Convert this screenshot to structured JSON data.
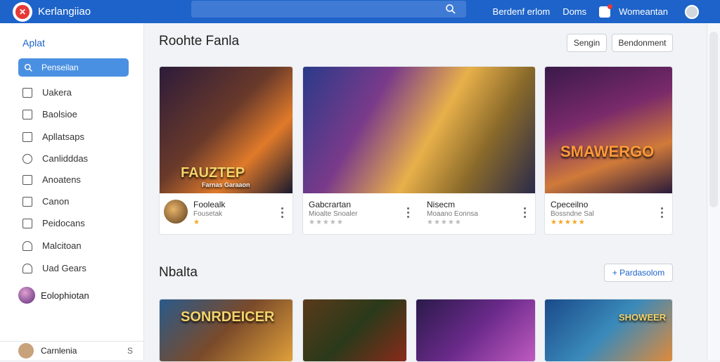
{
  "header": {
    "app_title": "Kerlangiiao",
    "links": [
      "Berdenf erlom",
      "Doms"
    ],
    "user_name": "Womeantan",
    "colors": {
      "bar": "#1d63c9"
    }
  },
  "sidebar": {
    "heading": "Aplat",
    "search_label": "Penseilan",
    "items": [
      {
        "label": "Uakera",
        "icon": "calendar-icon"
      },
      {
        "label": "Baolsioe",
        "icon": "chart-icon"
      },
      {
        "label": "Apllatsaps",
        "icon": "bar-chart-icon"
      },
      {
        "label": "Canlidddas",
        "icon": "search-icon"
      },
      {
        "label": "Anoatens",
        "icon": "list-icon"
      },
      {
        "label": "Canon",
        "icon": "bracket-icon"
      },
      {
        "label": "Peidocans",
        "icon": "image-icon"
      },
      {
        "label": "Malcitoan",
        "icon": "person-icon"
      },
      {
        "label": "Uad Gears",
        "icon": "user-icon"
      }
    ],
    "user_label": "Eolophiotan",
    "bottom_label": "Carnlenia",
    "bottom_num": "S"
  },
  "section1": {
    "title": "Roohte Fanla",
    "btn_sort": "Sengin",
    "btn_recommend": "Bendonment",
    "cards": [
      {
        "thumb_text": "FAUZTEP",
        "thumb_sub": "Farnas Garaaon",
        "name": "Foolealk",
        "dev": "Fousetak",
        "stars": "★",
        "has_avatar": true
      },
      {
        "thumb_text": "",
        "name": "Gabcrartan",
        "dev": "Mioalte Snoaler",
        "stars": "★★★★★",
        "grey": true
      },
      {
        "thumb_text": "",
        "name": "Nisecm",
        "dev": "Moaano Eonnsa",
        "stars": "★★★★★",
        "grey": true
      },
      {
        "thumb_text": "SMAWERGO",
        "name": "Cpeceilno",
        "dev": "Bossndne Sal",
        "stars": "★★★★★"
      }
    ]
  },
  "section2": {
    "title": "Nbalta",
    "btn_add": "+ Pardasolom",
    "thumb_texts": [
      "SONRDEICER",
      "",
      "",
      "SHOWEER"
    ]
  }
}
